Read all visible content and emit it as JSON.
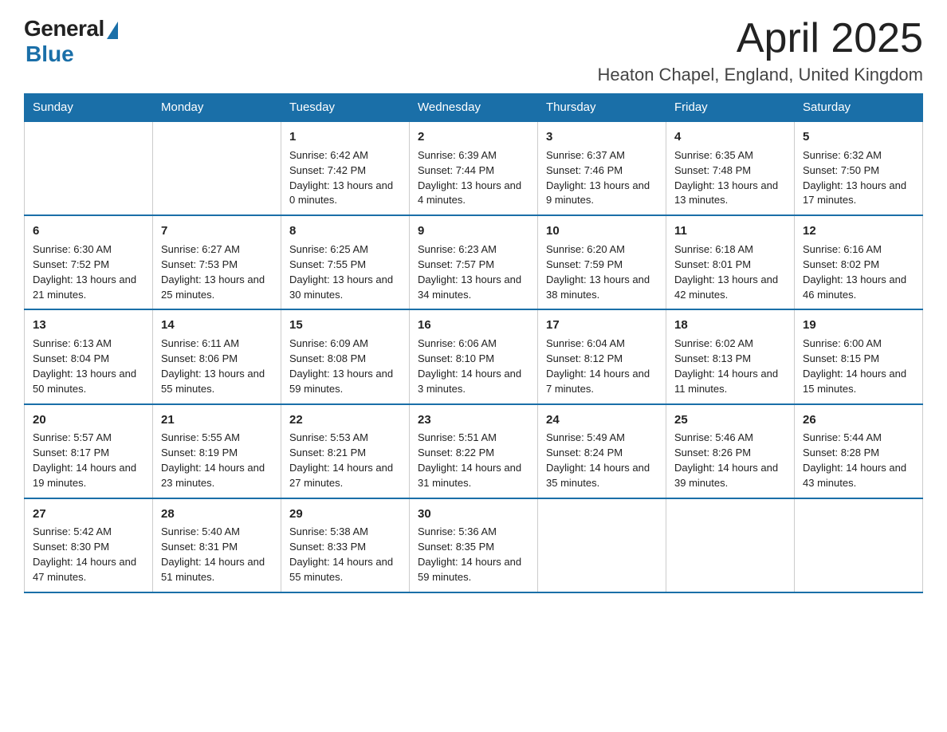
{
  "logo": {
    "general": "General",
    "blue": "Blue"
  },
  "title": "April 2025",
  "location": "Heaton Chapel, England, United Kingdom",
  "days_of_week": [
    "Sunday",
    "Monday",
    "Tuesday",
    "Wednesday",
    "Thursday",
    "Friday",
    "Saturday"
  ],
  "weeks": [
    [
      {
        "day": "",
        "sunrise": "",
        "sunset": "",
        "daylight": ""
      },
      {
        "day": "",
        "sunrise": "",
        "sunset": "",
        "daylight": ""
      },
      {
        "day": "1",
        "sunrise": "Sunrise: 6:42 AM",
        "sunset": "Sunset: 7:42 PM",
        "daylight": "Daylight: 13 hours and 0 minutes."
      },
      {
        "day": "2",
        "sunrise": "Sunrise: 6:39 AM",
        "sunset": "Sunset: 7:44 PM",
        "daylight": "Daylight: 13 hours and 4 minutes."
      },
      {
        "day": "3",
        "sunrise": "Sunrise: 6:37 AM",
        "sunset": "Sunset: 7:46 PM",
        "daylight": "Daylight: 13 hours and 9 minutes."
      },
      {
        "day": "4",
        "sunrise": "Sunrise: 6:35 AM",
        "sunset": "Sunset: 7:48 PM",
        "daylight": "Daylight: 13 hours and 13 minutes."
      },
      {
        "day": "5",
        "sunrise": "Sunrise: 6:32 AM",
        "sunset": "Sunset: 7:50 PM",
        "daylight": "Daylight: 13 hours and 17 minutes."
      }
    ],
    [
      {
        "day": "6",
        "sunrise": "Sunrise: 6:30 AM",
        "sunset": "Sunset: 7:52 PM",
        "daylight": "Daylight: 13 hours and 21 minutes."
      },
      {
        "day": "7",
        "sunrise": "Sunrise: 6:27 AM",
        "sunset": "Sunset: 7:53 PM",
        "daylight": "Daylight: 13 hours and 25 minutes."
      },
      {
        "day": "8",
        "sunrise": "Sunrise: 6:25 AM",
        "sunset": "Sunset: 7:55 PM",
        "daylight": "Daylight: 13 hours and 30 minutes."
      },
      {
        "day": "9",
        "sunrise": "Sunrise: 6:23 AM",
        "sunset": "Sunset: 7:57 PM",
        "daylight": "Daylight: 13 hours and 34 minutes."
      },
      {
        "day": "10",
        "sunrise": "Sunrise: 6:20 AM",
        "sunset": "Sunset: 7:59 PM",
        "daylight": "Daylight: 13 hours and 38 minutes."
      },
      {
        "day": "11",
        "sunrise": "Sunrise: 6:18 AM",
        "sunset": "Sunset: 8:01 PM",
        "daylight": "Daylight: 13 hours and 42 minutes."
      },
      {
        "day": "12",
        "sunrise": "Sunrise: 6:16 AM",
        "sunset": "Sunset: 8:02 PM",
        "daylight": "Daylight: 13 hours and 46 minutes."
      }
    ],
    [
      {
        "day": "13",
        "sunrise": "Sunrise: 6:13 AM",
        "sunset": "Sunset: 8:04 PM",
        "daylight": "Daylight: 13 hours and 50 minutes."
      },
      {
        "day": "14",
        "sunrise": "Sunrise: 6:11 AM",
        "sunset": "Sunset: 8:06 PM",
        "daylight": "Daylight: 13 hours and 55 minutes."
      },
      {
        "day": "15",
        "sunrise": "Sunrise: 6:09 AM",
        "sunset": "Sunset: 8:08 PM",
        "daylight": "Daylight: 13 hours and 59 minutes."
      },
      {
        "day": "16",
        "sunrise": "Sunrise: 6:06 AM",
        "sunset": "Sunset: 8:10 PM",
        "daylight": "Daylight: 14 hours and 3 minutes."
      },
      {
        "day": "17",
        "sunrise": "Sunrise: 6:04 AM",
        "sunset": "Sunset: 8:12 PM",
        "daylight": "Daylight: 14 hours and 7 minutes."
      },
      {
        "day": "18",
        "sunrise": "Sunrise: 6:02 AM",
        "sunset": "Sunset: 8:13 PM",
        "daylight": "Daylight: 14 hours and 11 minutes."
      },
      {
        "day": "19",
        "sunrise": "Sunrise: 6:00 AM",
        "sunset": "Sunset: 8:15 PM",
        "daylight": "Daylight: 14 hours and 15 minutes."
      }
    ],
    [
      {
        "day": "20",
        "sunrise": "Sunrise: 5:57 AM",
        "sunset": "Sunset: 8:17 PM",
        "daylight": "Daylight: 14 hours and 19 minutes."
      },
      {
        "day": "21",
        "sunrise": "Sunrise: 5:55 AM",
        "sunset": "Sunset: 8:19 PM",
        "daylight": "Daylight: 14 hours and 23 minutes."
      },
      {
        "day": "22",
        "sunrise": "Sunrise: 5:53 AM",
        "sunset": "Sunset: 8:21 PM",
        "daylight": "Daylight: 14 hours and 27 minutes."
      },
      {
        "day": "23",
        "sunrise": "Sunrise: 5:51 AM",
        "sunset": "Sunset: 8:22 PM",
        "daylight": "Daylight: 14 hours and 31 minutes."
      },
      {
        "day": "24",
        "sunrise": "Sunrise: 5:49 AM",
        "sunset": "Sunset: 8:24 PM",
        "daylight": "Daylight: 14 hours and 35 minutes."
      },
      {
        "day": "25",
        "sunrise": "Sunrise: 5:46 AM",
        "sunset": "Sunset: 8:26 PM",
        "daylight": "Daylight: 14 hours and 39 minutes."
      },
      {
        "day": "26",
        "sunrise": "Sunrise: 5:44 AM",
        "sunset": "Sunset: 8:28 PM",
        "daylight": "Daylight: 14 hours and 43 minutes."
      }
    ],
    [
      {
        "day": "27",
        "sunrise": "Sunrise: 5:42 AM",
        "sunset": "Sunset: 8:30 PM",
        "daylight": "Daylight: 14 hours and 47 minutes."
      },
      {
        "day": "28",
        "sunrise": "Sunrise: 5:40 AM",
        "sunset": "Sunset: 8:31 PM",
        "daylight": "Daylight: 14 hours and 51 minutes."
      },
      {
        "day": "29",
        "sunrise": "Sunrise: 5:38 AM",
        "sunset": "Sunset: 8:33 PM",
        "daylight": "Daylight: 14 hours and 55 minutes."
      },
      {
        "day": "30",
        "sunrise": "Sunrise: 5:36 AM",
        "sunset": "Sunset: 8:35 PM",
        "daylight": "Daylight: 14 hours and 59 minutes."
      },
      {
        "day": "",
        "sunrise": "",
        "sunset": "",
        "daylight": ""
      },
      {
        "day": "",
        "sunrise": "",
        "sunset": "",
        "daylight": ""
      },
      {
        "day": "",
        "sunrise": "",
        "sunset": "",
        "daylight": ""
      }
    ]
  ]
}
